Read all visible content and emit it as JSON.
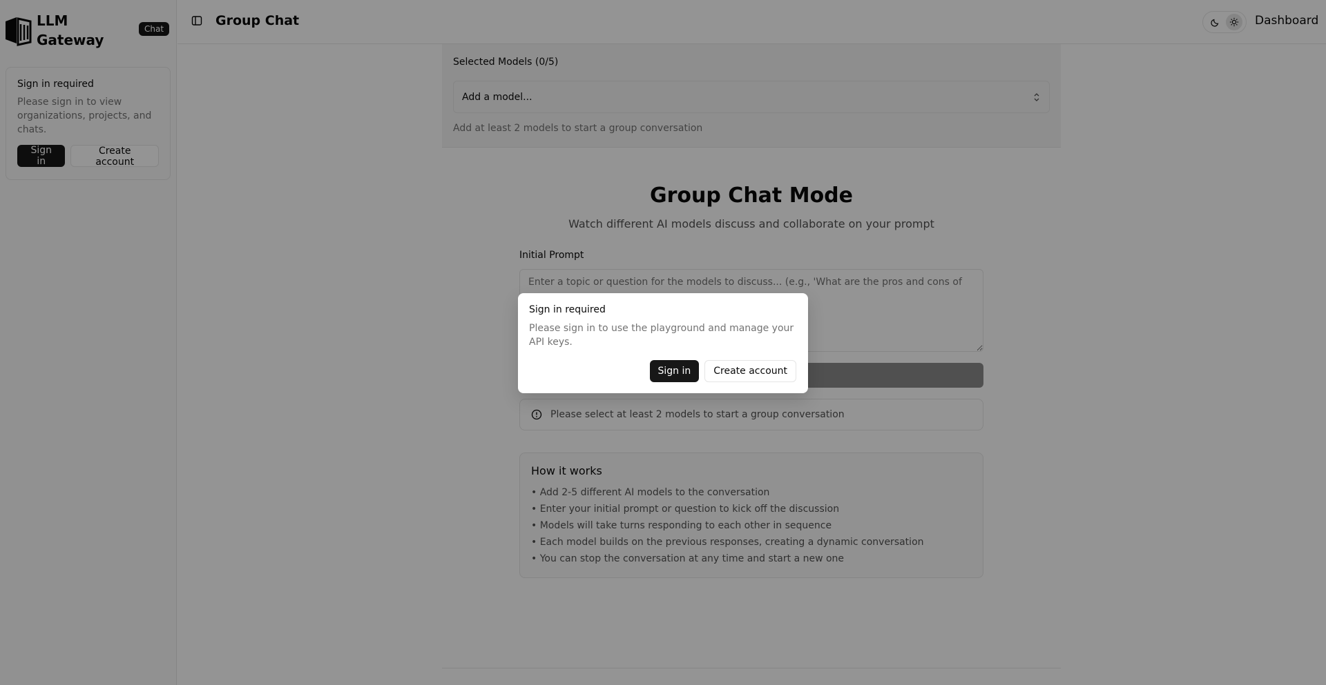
{
  "sidebar": {
    "brand": "LLM Gateway",
    "badge": "Chat",
    "signin_card": {
      "title": "Sign in required",
      "description": "Please sign in to view organizations, projects, and chats.",
      "signin_label": "Sign in",
      "create_label": "Create account"
    }
  },
  "header": {
    "title": "Group Chat",
    "dashboard_label": "Dashboard",
    "theme_options": [
      "moon-icon",
      "sun-icon"
    ]
  },
  "models": {
    "label": "Selected Models (0/5)",
    "placeholder": "Add a model...",
    "hint": "Add at least 2 models to start a group conversation"
  },
  "hero": {
    "title": "Group Chat Mode",
    "subtitle": "Watch different AI models discuss and collaborate on your prompt"
  },
  "prompt": {
    "label": "Initial Prompt",
    "placeholder": "Enter a topic or question for the models to discuss... (e.g., 'What are the pros and cons of",
    "value": ""
  },
  "alert": {
    "text": "Please select at least 2 models to start a group conversation"
  },
  "how_it_works": {
    "title": "How it works",
    "items": [
      "• Add 2-5 different AI models to the conversation",
      "• Enter your initial prompt or question to kick off the discussion",
      "• Models will take turns responding to each other in sequence",
      "• Each model builds on the previous responses, creating a dynamic conversation",
      "• You can stop the conversation at any time and start a new one"
    ]
  },
  "dialog": {
    "title": "Sign in required",
    "description": "Please sign in to use the playground and manage your API keys.",
    "signin_label": "Sign in",
    "create_label": "Create account"
  },
  "colors": {
    "primary": "#171717",
    "muted_text": "#737373",
    "border": "#e5e5e5",
    "overlay": "rgba(0,0,0,0.42)"
  }
}
